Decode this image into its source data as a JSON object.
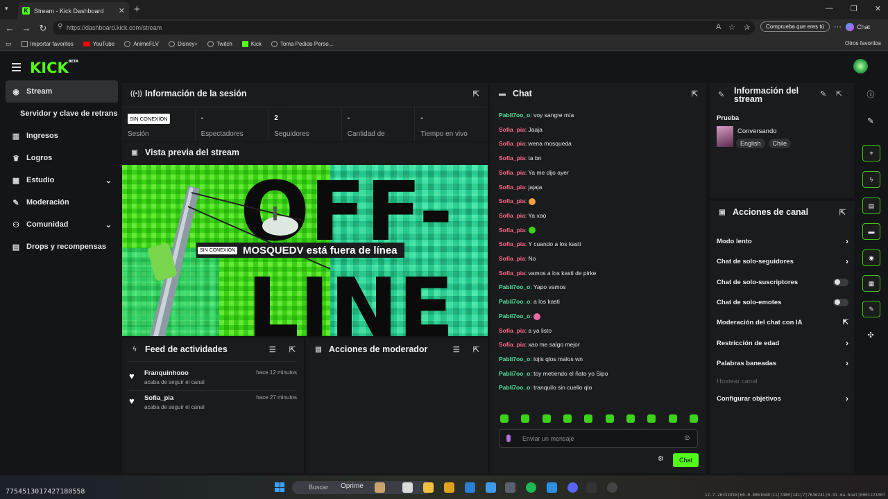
{
  "browser": {
    "tab_title": "Stream - Kick Dashboard",
    "url_host": "https://dashboard.kick.com",
    "url_path": "/stream",
    "profile_prompt": "Comprueba que eres tú",
    "copilot_label": "Chat",
    "bookmarks": [
      "Importar favoritos",
      "YouTube",
      "AnimeFLV",
      "Disney+",
      "Twitch",
      "Kick",
      "Toma Pedido Perso..."
    ],
    "other_bookmarks": "Otros favoritos"
  },
  "app": {
    "logo": "KICK",
    "logo_badge": "BETA"
  },
  "sidebar": {
    "items": [
      {
        "label": "Stream",
        "icon": "broadcast-icon",
        "glyph": "((•))"
      },
      {
        "label": "Servidor y clave de retransmisión",
        "icon": "",
        "glyph": ""
      },
      {
        "label": "Ingresos",
        "icon": "chart-icon",
        "glyph": "▥"
      },
      {
        "label": "Logros",
        "icon": "trophy-icon",
        "glyph": "🏆"
      },
      {
        "label": "Estudio",
        "icon": "studio-icon",
        "glyph": "▦"
      },
      {
        "label": "Moderación",
        "icon": "wrench-icon",
        "glyph": "🔧"
      },
      {
        "label": "Comunidad",
        "icon": "community-icon",
        "glyph": "👥"
      },
      {
        "label": "Drops y recompensas",
        "icon": "drops-icon",
        "glyph": "▤"
      }
    ]
  },
  "session": {
    "title": "Información de la sesión",
    "status_badge": "SIN CONEXIÓN",
    "stats": [
      {
        "value": "",
        "label": "Sesión"
      },
      {
        "value": "-",
        "label": "Espectadores"
      },
      {
        "value": "2",
        "label": "Seguidores"
      },
      {
        "value": "-",
        "label": "Cantidad de"
      },
      {
        "value": "-",
        "label": "Tiempo en vivo"
      }
    ]
  },
  "preview": {
    "title": "Vista previa del stream",
    "status_badge": "SIN CONEXIÓN",
    "message": "MOSQUEDV está fuera de línea",
    "bg_text_top": "OFF-",
    "bg_text_bottom": "LINE"
  },
  "feed": {
    "title": "Feed de actividades",
    "items": [
      {
        "user": "Franquinhooo",
        "desc": "acaba de seguir el canal",
        "time": "hace 12 minutos"
      },
      {
        "user": "Sofia_pia",
        "desc": "acaba de seguir el canal",
        "time": "hace 27 minutos"
      }
    ]
  },
  "mod_actions": {
    "title": "Acciones de moderador"
  },
  "chat": {
    "title": "Chat",
    "messages": [
      {
        "user": "Pabli7oo_o",
        "text": "voy sangre mía",
        "color": "#53e1a0"
      },
      {
        "user": "Sofia_pia",
        "text": "Jaaja",
        "color": "#ff6b8b"
      },
      {
        "user": "Sofia_pia",
        "text": "wena mosqueda",
        "color": "#ff6b8b"
      },
      {
        "user": "Sofia_pia",
        "text": "ta bn",
        "color": "#ff6b8b"
      },
      {
        "user": "Sofia_pia",
        "text": "Ya me dijo ayer",
        "color": "#ff6b8b"
      },
      {
        "user": "Sofia_pia",
        "text": "jajaja",
        "color": "#ff6b8b"
      },
      {
        "user": "Sofia_pia",
        "text": "",
        "color": "#ff6b8b",
        "emote": "#f0a040"
      },
      {
        "user": "Sofia_pia",
        "text": "Ya xao",
        "color": "#ff6b8b"
      },
      {
        "user": "Sofia_pia",
        "text": "",
        "color": "#ff6b8b",
        "emote": "#3ed11a"
      },
      {
        "user": "Sofia_pia",
        "text": "Y cuando a los kasti",
        "color": "#ff6b8b"
      },
      {
        "user": "Sofia_pia",
        "text": "No",
        "color": "#ff6b8b"
      },
      {
        "user": "Sofia_pia",
        "text": "vamos a los kasti de pirke",
        "color": "#ff6b8b"
      },
      {
        "user": "Pabli7oo_o",
        "text": "Yapo vamos",
        "color": "#53e1a0"
      },
      {
        "user": "Pabli7oo_o",
        "text": "a los kasti",
        "color": "#53e1a0"
      },
      {
        "user": "Pabli7oo_o",
        "text": "",
        "color": "#53e1a0",
        "emote": "#e86aa0"
      },
      {
        "user": "Sofia_pia",
        "text": "a ya listo",
        "color": "#ff6b8b"
      },
      {
        "user": "Sofia_pia",
        "text": "xao me salgo mejor",
        "color": "#ff6b8b"
      },
      {
        "user": "Pabli7oo_o",
        "text": "lojis qlos malos wn",
        "color": "#53e1a0"
      },
      {
        "user": "Pabli7oo_o",
        "text": "toy metiendo el ñato yo Sipo",
        "color": "#53e1a0"
      },
      {
        "user": "Pabli7oo_o",
        "text": "tranquilo sin cuello qlo",
        "color": "#53e1a0"
      }
    ],
    "input_placeholder": "Enviar un mensaje",
    "send_label": "Chat"
  },
  "stream_info": {
    "title": "Información del stream",
    "stream_title": "Prueba",
    "category": "Conversando",
    "tags": [
      "English",
      "Chile"
    ]
  },
  "channel_actions": {
    "title": "Acciones de canal",
    "items": [
      {
        "label": "Modo lento",
        "control": "arrow"
      },
      {
        "label": "Chat de solo-seguidores",
        "control": "arrow"
      },
      {
        "label": "Chat de solo-suscriptores",
        "control": "toggle"
      },
      {
        "label": "Chat de solo-emotes",
        "control": "toggle"
      },
      {
        "label": "Moderación del chat con IA",
        "control": "external"
      },
      {
        "label": "Restricción de edad",
        "control": "arrow"
      },
      {
        "label": "Palabras baneadas",
        "control": "arrow"
      },
      {
        "label": "Hostear canal",
        "control": "none"
      },
      {
        "label": "Configurar objetivos",
        "control": "arrow"
      }
    ]
  },
  "taskbar": {
    "left_number": "7754513017427180558",
    "search_placeholder": "Buscar",
    "overlay_text": "Oprime",
    "right_text": "12.7.26331916|60-0.8061040|11|7400|141|7|7636241|0.91.6a.bnet|0001221007"
  },
  "colors": {
    "accent": "#53fc18",
    "panel": "#191b1d",
    "background": "#141517"
  }
}
